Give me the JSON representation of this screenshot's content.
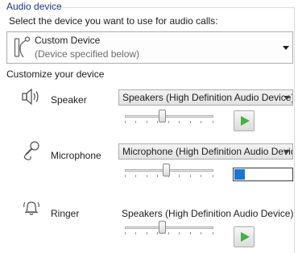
{
  "group": {
    "title": "Audio device"
  },
  "instruction": "Select the device you want to use for audio calls:",
  "device": {
    "name": "Custom Device",
    "subtitle": "(Device specified below)",
    "icon": "microphone-speaker-icon"
  },
  "customize_label": "Customize your device",
  "speaker": {
    "label": "Speaker",
    "icon": "speaker-icon",
    "selected": "Speakers (High Definition Audio Device)",
    "volume": 0.42,
    "play_icon": "play-icon"
  },
  "microphone": {
    "label": "Microphone",
    "icon": "microphone-icon",
    "selected": "Microphone (High Definition Audio Device)",
    "volume": 0.47,
    "level": 0.18
  },
  "ringer": {
    "label": "Ringer",
    "icon": "bell-icon",
    "device_text": "Speakers (High Definition Audio Device)",
    "volume": 0.42,
    "play_icon": "play-icon"
  },
  "colors": {
    "accent_text": "#1e3287",
    "play_green": "#3fb43f",
    "meter_blue": "#1c75d3"
  }
}
